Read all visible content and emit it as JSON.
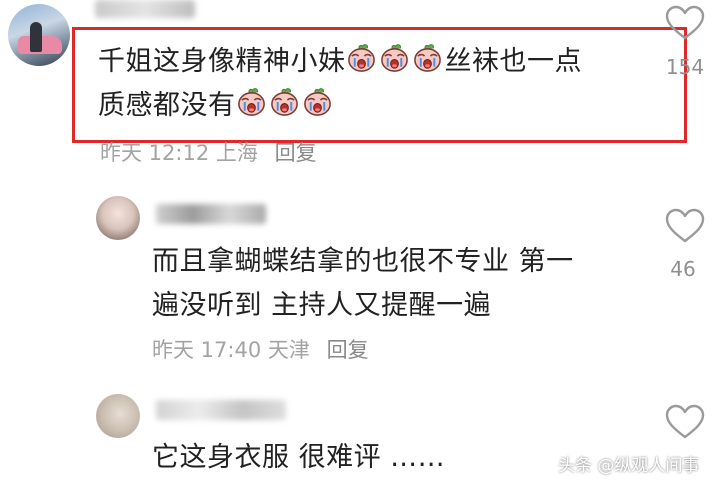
{
  "comments": [
    {
      "text_part1": "千姐这身像精神小妹",
      "text_part2": "丝袜也一点",
      "text_line2": "质感都没有",
      "emoji_icons": [
        "crying-peach-icon",
        "crying-peach-icon",
        "crying-peach-icon"
      ],
      "time": "昨天 12:12",
      "location": "上海",
      "reply_label": "回复",
      "likes": "154"
    },
    {
      "text_line1": "而且拿蝴蝶结拿的也很不专业 第一",
      "text_line2": "遍没听到 主持人又提醒一遍",
      "time": "昨天 17:40",
      "location": "天津",
      "reply_label": "回复",
      "likes": "46"
    },
    {
      "text_line1": "它这身衣服 很难评 ……"
    }
  ],
  "watermark": "头条 @纵观人间事",
  "colors": {
    "highlight": "#e0282b",
    "meta_text": "#a3a3a3",
    "body_text": "#222222"
  }
}
